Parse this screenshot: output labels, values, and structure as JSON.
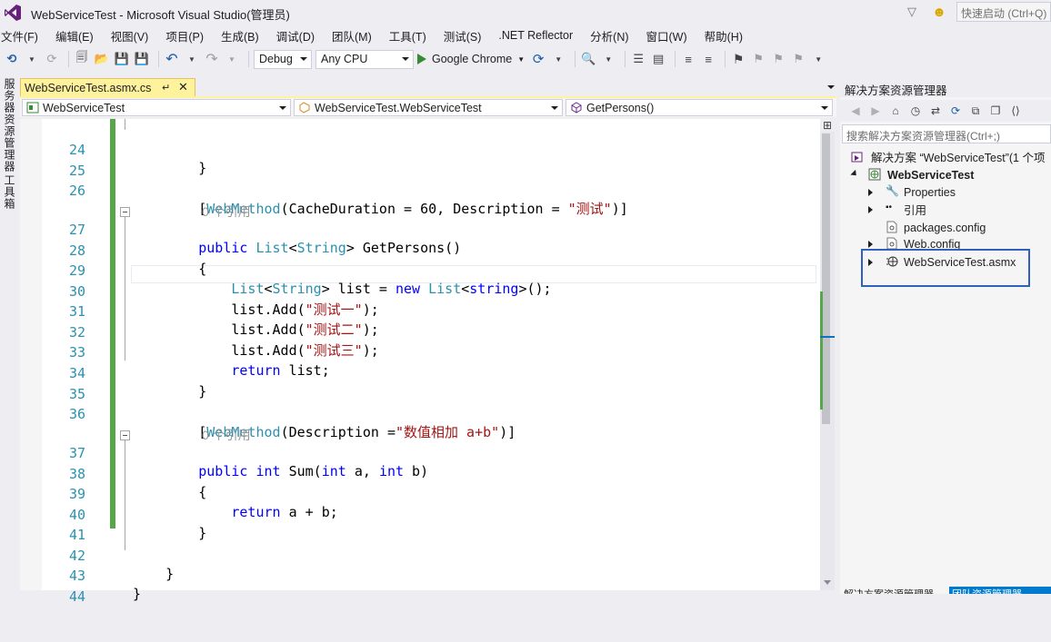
{
  "window": {
    "title": "WebServiceTest - Microsoft Visual Studio(管理员)",
    "quick_launch_placeholder": "快速启动 (Ctrl+Q)"
  },
  "menu": [
    "文件(F)",
    "编辑(E)",
    "视图(V)",
    "项目(P)",
    "生成(B)",
    "调试(D)",
    "团队(M)",
    "工具(T)",
    "测试(S)",
    ".NET Reflector",
    "分析(N)",
    "窗口(W)",
    "帮助(H)"
  ],
  "toolbar": {
    "config": "Debug",
    "platform": "Any CPU",
    "run_target": "Google Chrome"
  },
  "left_strip": {
    "server_explorer": "服务器资源管理器",
    "toolbox": "工具箱"
  },
  "editor": {
    "tab_label": "WebServiceTest.asmx.cs",
    "nav_project": "WebServiceTest",
    "nav_class": "WebServiceTest.WebServiceTest",
    "nav_member": "GetPersons()",
    "lines": [
      {
        "n": "24",
        "text": "        }"
      },
      {
        "n": "25",
        "text": ""
      },
      {
        "n": "26",
        "text": "        [WebMethod(CacheDuration = 60, Description = \"测试\")]"
      },
      {
        "n": "",
        "lens": "0 个引用"
      },
      {
        "n": "27",
        "text": "        public List<String> GetPersons()"
      },
      {
        "n": "28",
        "text": "        {"
      },
      {
        "n": "29",
        "text": "            List<String> list = new List<string>();"
      },
      {
        "n": "30",
        "text": "            list.Add(\"测试一\");"
      },
      {
        "n": "31",
        "text": "            list.Add(\"测试二\");"
      },
      {
        "n": "32",
        "text": "            list.Add(\"测试三\");"
      },
      {
        "n": "33",
        "text": "            return list;"
      },
      {
        "n": "34",
        "text": "        }"
      },
      {
        "n": "35",
        "text": ""
      },
      {
        "n": "36",
        "text": "        [WebMethod(Description =\"数值相加 a+b\")]"
      },
      {
        "n": "",
        "lens": "0 个引用"
      },
      {
        "n": "37",
        "text": "        public int Sum(int a, int b)"
      },
      {
        "n": "38",
        "text": "        {"
      },
      {
        "n": "39",
        "text": "            return a + b;"
      },
      {
        "n": "40",
        "text": "        }"
      },
      {
        "n": "41",
        "text": ""
      },
      {
        "n": "42",
        "text": "    }"
      },
      {
        "n": "43",
        "text": "}"
      },
      {
        "n": "44",
        "text": ""
      }
    ]
  },
  "solution_explorer": {
    "title": "解决方案资源管理器",
    "search_placeholder": "搜索解决方案资源管理器(Ctrl+;)",
    "tree": [
      {
        "label": "解决方案 “WebServiceTest”(1 个项",
        "icon": "solution-icon",
        "expand": "none",
        "bold": false
      },
      {
        "label": "WebServiceTest",
        "icon": "web-project-icon",
        "expand": "expanded",
        "bold": true
      },
      {
        "label": "Properties",
        "icon": "wrench-icon",
        "expand": "collapsed",
        "bold": false
      },
      {
        "label": "引用",
        "icon": "references-icon",
        "expand": "collapsed",
        "bold": false
      },
      {
        "label": "packages.config",
        "icon": "config-file-icon",
        "expand": "none",
        "bold": false
      },
      {
        "label": "Web.config",
        "icon": "config-file-icon",
        "expand": "collapsed",
        "bold": false
      },
      {
        "label": "WebServiceTest.asmx",
        "icon": "web-service-icon",
        "expand": "collapsed",
        "bold": false
      }
    ],
    "bottom_tabs": [
      "解决方案资源管理器",
      "团队资源管理器"
    ]
  }
}
